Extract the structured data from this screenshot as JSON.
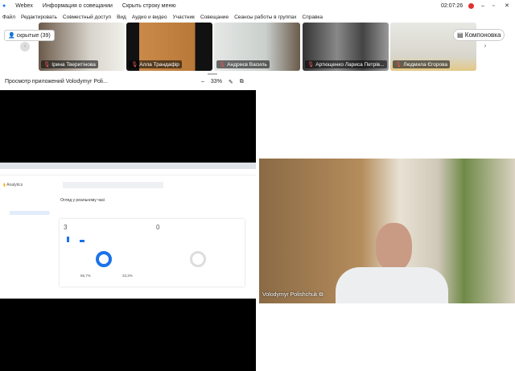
{
  "titlebar": {
    "app": "Webex",
    "meeting_info": "Информация о совещании",
    "hide_menu": "Скрыть строку меню",
    "time": "02:07:26"
  },
  "menu": [
    "Файл",
    "Редактировать",
    "Совместный доступ",
    "Вид",
    "Аудио и видео",
    "Участник",
    "Совещание",
    "Сеансы работы в группах",
    "Справка"
  ],
  "hidden_button": "скрытые (39)",
  "layout_button": "Компоновка",
  "participants": [
    "Ірина Тверитінова",
    "Алла Трандафір",
    "Андреєв Василь",
    "Артющенко Лариса Петрів...",
    "Людмила Єгорова"
  ],
  "viewer": {
    "title": "Просмотр приложений Volodymyr Poli...",
    "zoom": "33%"
  },
  "shared": {
    "app": "Analytics",
    "heading": "Огляд у реальному часі",
    "metric1": "3",
    "metric2": "0",
    "pct1": "66,7%",
    "pct2": "33,3%"
  },
  "speaker": {
    "name": "Volodymyr Polishchuk"
  }
}
